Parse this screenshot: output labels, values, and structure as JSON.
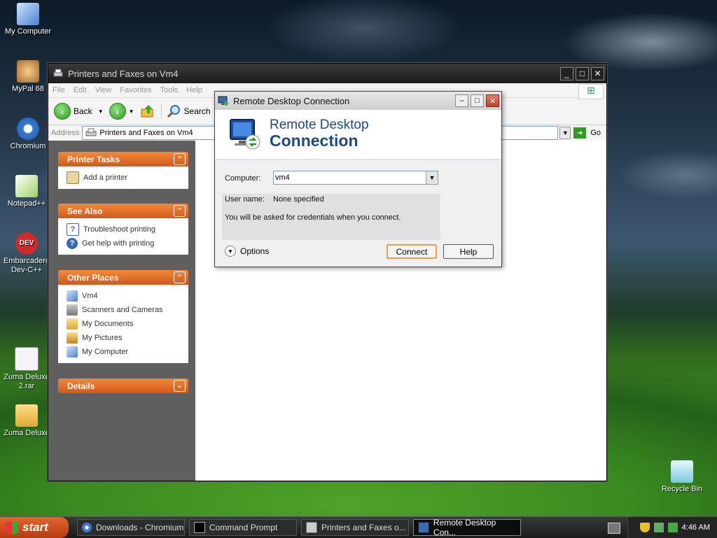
{
  "desktop": {
    "icons": [
      {
        "label": "My Computer",
        "color": "#6aa0e0"
      },
      {
        "label": "MyPal 68",
        "color": "#c08040"
      },
      {
        "label": "Chromium",
        "color": "#3a7ad0"
      },
      {
        "label": "Notepad++",
        "color": "#7fb04a"
      },
      {
        "label": "Embarcadero Dev-C++",
        "color": "#d02a2a"
      },
      {
        "label": "Zuma Deluxe 2.rar",
        "color": "#e8e8f0"
      },
      {
        "label": "Zuma Deluxe",
        "color": "#f0c040"
      },
      {
        "label": "Recycle Bin",
        "color": "#8ad0e0"
      }
    ]
  },
  "explorer": {
    "title": "Printers and Faxes on Vm4",
    "menu": [
      "File",
      "Edit",
      "View",
      "Favorites",
      "Tools",
      "Help"
    ],
    "toolbar": {
      "back": "Back",
      "search": "Search"
    },
    "address": {
      "label": "Address",
      "value": "Printers and Faxes on Vm4",
      "go": "Go"
    },
    "panels": {
      "printer_tasks": {
        "title": "Printer Tasks",
        "items": [
          "Add a printer"
        ]
      },
      "see_also": {
        "title": "See Also",
        "items": [
          "Troubleshoot printing",
          "Get help with printing"
        ]
      },
      "other_places": {
        "title": "Other Places",
        "items": [
          "Vm4",
          "Scanners and Cameras",
          "My Documents",
          "My Pictures",
          "My Computer"
        ]
      },
      "details": {
        "title": "Details"
      }
    }
  },
  "rdc": {
    "title": "Remote Desktop Connection",
    "banner_line1": "Remote Desktop",
    "banner_line2": "Connection",
    "computer_label": "Computer:",
    "computer_value": "vm4",
    "username_label": "User name:",
    "username_value": "None specified",
    "info_text": "You will be asked for credentials when you connect.",
    "options_label": "Options",
    "connect_label": "Connect",
    "help_label": "Help"
  },
  "taskbar": {
    "start": "start",
    "tasks": [
      "Downloads - Chromium",
      "Command Prompt",
      "Printers and Faxes o...",
      "Remote Desktop Con..."
    ],
    "clock": "4:46 AM"
  }
}
